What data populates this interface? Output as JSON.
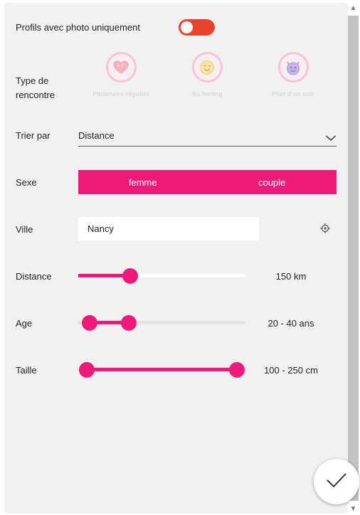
{
  "filters": {
    "photo_only": {
      "label": "Profils avec photo uniquement",
      "enabled": true
    },
    "meeting_type": {
      "label_line1": "Type de",
      "label_line2": "rencontre",
      "options": [
        {
          "label": "Partenaire régulier",
          "icon": "heart-icon"
        },
        {
          "label": "Au feeling",
          "icon": "smile-icon"
        },
        {
          "label": "Plan d'un soir",
          "icon": "devil-icon"
        }
      ]
    },
    "sort": {
      "label": "Trier par",
      "value": "Distance"
    },
    "gender": {
      "label": "Sexe",
      "options": [
        "femme",
        "couple"
      ]
    },
    "city": {
      "label": "Ville",
      "value": "Nancy"
    },
    "distance": {
      "label": "Distance",
      "value_text": "150 km",
      "fraction": 0.31
    },
    "age": {
      "label": "Age",
      "value_text": "20 - 40 ans",
      "low_fraction": 0.07,
      "high_fraction": 0.3
    },
    "height": {
      "label": "Taille",
      "value_text": "100 - 250 cm",
      "low_fraction": 0.05,
      "high_fraction": 0.95
    }
  },
  "colors": {
    "accent": "#ee1979",
    "toggle_on": "#e8442c",
    "panel_bg": "#f2f1f2"
  }
}
